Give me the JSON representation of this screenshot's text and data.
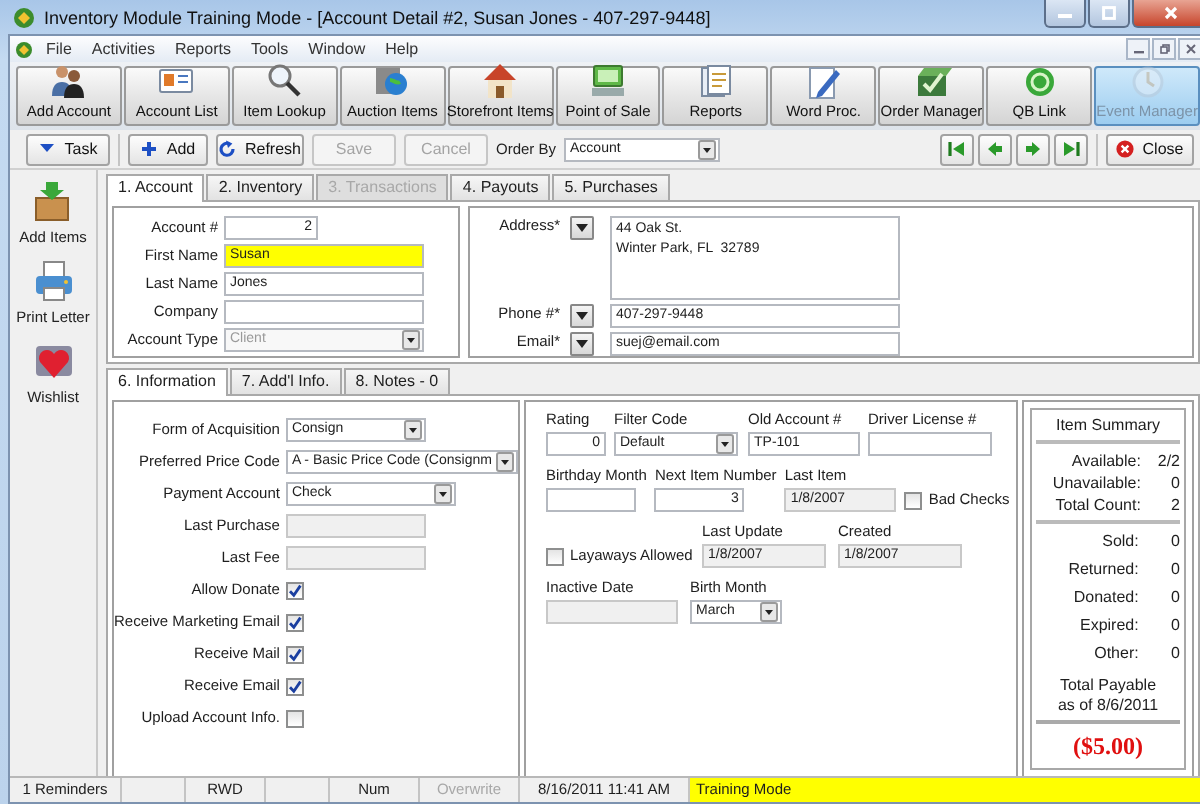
{
  "window": {
    "title": "Inventory Module Training Mode - [Account Detail #2, Susan Jones - 407-297-9448]"
  },
  "menu": [
    "File",
    "Activities",
    "Reports",
    "Tools",
    "Window",
    "Help"
  ],
  "toolbar": [
    {
      "label": "Add Account",
      "selected": false
    },
    {
      "label": "Account List",
      "selected": false
    },
    {
      "label": "Item Lookup",
      "selected": false
    },
    {
      "label": "Auction Items",
      "selected": false
    },
    {
      "label": "Storefront Items",
      "selected": false
    },
    {
      "label": "Point of Sale",
      "selected": false
    },
    {
      "label": "Reports",
      "selected": false
    },
    {
      "label": "Word Proc.",
      "selected": false
    },
    {
      "label": "Order Manager",
      "selected": false
    },
    {
      "label": "QB Link",
      "selected": false
    },
    {
      "label": "Event Manager",
      "selected": true
    }
  ],
  "actions": {
    "buttons": [
      {
        "label": "Task",
        "disabled": false
      },
      {
        "label": "Add",
        "disabled": false
      },
      {
        "label": "Refresh",
        "disabled": false
      },
      {
        "label": "Save",
        "disabled": true
      },
      {
        "label": "Cancel",
        "disabled": true
      }
    ],
    "order_by": {
      "label": "Order By",
      "value": "Account"
    },
    "close": "Close"
  },
  "sidebar": [
    "Add Items",
    "Print Letter",
    "Wishlist"
  ],
  "tabs": [
    {
      "label": "1. Account",
      "selected": true,
      "disabled": false
    },
    {
      "label": "2. Inventory",
      "selected": false,
      "disabled": false
    },
    {
      "label": "3. Transactions",
      "selected": false,
      "disabled": true
    },
    {
      "label": "4. Payouts",
      "selected": false,
      "disabled": false
    },
    {
      "label": "5. Purchases",
      "selected": false,
      "disabled": false
    }
  ],
  "account": [
    {
      "label": "Account #",
      "value": "2",
      "kind": "number",
      "highlighted": false
    },
    {
      "label": "First Name",
      "value": "Susan",
      "kind": "text",
      "highlighted": true
    },
    {
      "label": "Last Name",
      "value": "Jones",
      "kind": "text",
      "highlighted": false
    },
    {
      "label": "Company",
      "kind": "text",
      "highlighted": false
    },
    {
      "label": "Account Type",
      "value": "Client",
      "kind": "select_disabled",
      "highlighted": false
    }
  ],
  "contact": [
    {
      "label": "Address*",
      "value": "44 Oak St.\nWinter Park, FL  32789",
      "kind": "multiline"
    },
    {
      "label": "Phone #*",
      "value": "407-297-9448",
      "kind": "text"
    },
    {
      "label": "Email*",
      "value": "suej@email.com",
      "kind": "text"
    }
  ],
  "info_tabs": [
    {
      "label": "6. Information",
      "selected": true
    },
    {
      "label": "7. Add'l Info.",
      "selected": false
    },
    {
      "label": "8. Notes - 0",
      "selected": false
    }
  ],
  "info": [
    {
      "label": "Form of Acquisition",
      "kind": "select",
      "value": "Consign"
    },
    {
      "label": "Preferred Price Code",
      "kind": "select",
      "value": "A - Basic Price Code (Consignm"
    },
    {
      "label": "Payment Account",
      "kind": "select",
      "value": "Check"
    },
    {
      "label": "Last Purchase",
      "kind": "readonly"
    },
    {
      "label": "Last Fee",
      "kind": "readonly"
    },
    {
      "label": "Allow Donate",
      "kind": "checkbox",
      "checked": true
    },
    {
      "label": "Receive Marketing Email",
      "kind": "checkbox",
      "checked": true
    },
    {
      "label": "Receive Mail",
      "kind": "checkbox",
      "checked": true
    },
    {
      "label": "Receive Email",
      "kind": "checkbox",
      "checked": true
    },
    {
      "label": "Upload Account Info.",
      "kind": "checkbox",
      "checked": false
    }
  ],
  "details": [
    [
      {
        "label": "Rating",
        "kind": "number",
        "value": "0"
      },
      {
        "label": "Filter Code",
        "kind": "select",
        "value": "Default"
      },
      {
        "label": "Old Account #",
        "kind": "text",
        "value": "TP-101"
      },
      {
        "label": "Driver License #",
        "kind": "text"
      }
    ],
    [
      {
        "label": "Birthday Month",
        "kind": "text"
      },
      {
        "label": "Next Item Number",
        "kind": "number",
        "value": "3"
      },
      {
        "label": "Last Item",
        "kind": "readonly",
        "value": "1/8/2007"
      },
      {
        "label": "Bad Checks",
        "kind": "checkbox",
        "checked": false
      }
    ],
    [
      {
        "label": "Layaways Allowed",
        "kind": "checkbox",
        "checked": false
      },
      {
        "label": "Last Update",
        "kind": "readonly",
        "value": "1/8/2007"
      },
      {
        "label": "Created",
        "kind": "readonly",
        "value": "1/8/2007"
      }
    ],
    [
      {
        "label": "Inactive Date",
        "kind": "readonly"
      },
      {
        "label": "Birth Month",
        "kind": "select",
        "value": "March"
      }
    ]
  ],
  "summary": {
    "title": "Item Summary",
    "groups": [
      [
        {
          "label": "Available:",
          "value": "2/2"
        },
        {
          "label": "Unavailable:",
          "value": "0"
        },
        {
          "label": "Total Count:",
          "value": "2"
        }
      ],
      [
        {
          "label": "Sold:",
          "value": "0"
        },
        {
          "label": "Returned:",
          "value": "0"
        },
        {
          "label": "Donated:",
          "value": "0"
        },
        {
          "label": "Expired:",
          "value": "0"
        },
        {
          "label": "Other:",
          "value": "0"
        }
      ]
    ],
    "total_label": "Total Payable\nas of 8/6/2011",
    "total": "($5.00)"
  },
  "status_bar": [
    {
      "text": "1 Reminders",
      "disabled": false,
      "highlighted": false
    },
    {
      "text": "RWD",
      "disabled": false,
      "highlighted": false
    },
    {
      "text": "Num",
      "disabled": false,
      "highlighted": false
    },
    {
      "text": "Overwrite",
      "disabled": true,
      "highlighted": false
    },
    {
      "text": "8/16/2011 11:41 AM",
      "disabled": false,
      "highlighted": false
    },
    {
      "text": "Training Mode",
      "disabled": false,
      "highlighted": true
    }
  ]
}
